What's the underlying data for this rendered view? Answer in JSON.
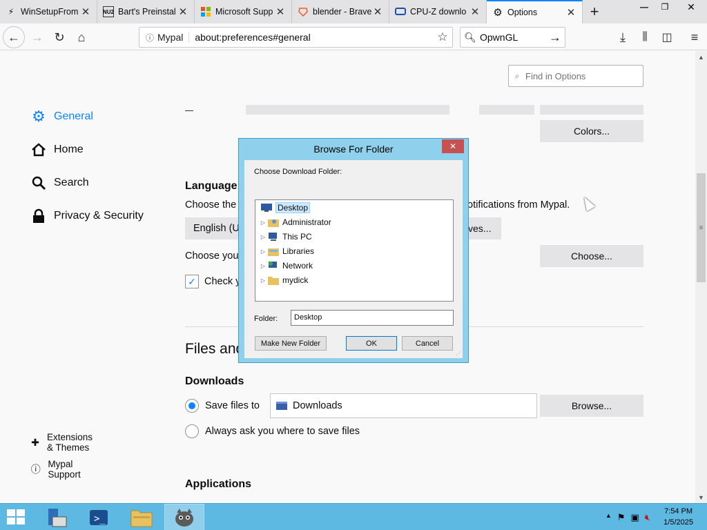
{
  "tabs": [
    {
      "title": "WinSetupFrom",
      "icon": "usb-icon"
    },
    {
      "title": "Bart's Preinstal",
      "icon": "nu2-icon"
    },
    {
      "title": "Microsoft Supp",
      "icon": "microsoft-icon"
    },
    {
      "title": "blender - Brave",
      "icon": "brave-icon"
    },
    {
      "title": "CPU-Z downlo",
      "icon": "cpuz-icon"
    },
    {
      "title": "Options",
      "icon": "gear-icon",
      "active": true
    }
  ],
  "toolbar": {
    "identity": "Mypal",
    "url": "about:preferences#general",
    "search_value": "OpwnGL"
  },
  "find": {
    "placeholder": "Find in Options"
  },
  "sidebar": {
    "items": [
      {
        "label": "General",
        "icon": "gear-icon",
        "active": true
      },
      {
        "label": "Home",
        "icon": "home-icon"
      },
      {
        "label": "Search",
        "icon": "search-icon"
      },
      {
        "label": "Privacy & Security",
        "icon": "lock-icon"
      }
    ],
    "footer": [
      {
        "label": "Extensions & Themes",
        "icon": "puzzle-icon"
      },
      {
        "label": "Mypal Support",
        "icon": "help-icon"
      }
    ]
  },
  "main": {
    "colors_button": "Colors...",
    "language_heading": "Language",
    "language_text_start": "Choose the",
    "language_text_end": "otifications from Mypal.",
    "language_select": "English (U",
    "alternatives_button_end": "ves...",
    "choose_text": "Choose you",
    "choose_button": "Choose...",
    "check_text": "Check y",
    "files_heading": "Files and",
    "downloads_heading": "Downloads",
    "save_files_label": "Save files to",
    "download_path": "Downloads",
    "browse_button": "Browse...",
    "always_ask_label": "Always ask you where to save files",
    "applications_heading": "Applications"
  },
  "dialog": {
    "title": "Browse For Folder",
    "prompt": "Choose Download Folder:",
    "tree": [
      {
        "label": "Desktop",
        "selected": true,
        "expandable": false
      },
      {
        "label": "Administrator",
        "expandable": true
      },
      {
        "label": "This PC",
        "expandable": true
      },
      {
        "label": "Libraries",
        "expandable": true
      },
      {
        "label": "Network",
        "expandable": true
      },
      {
        "label": "mydick",
        "expandable": true
      }
    ],
    "folder_label": "Folder:",
    "folder_value": "Desktop",
    "make_new_folder": "Make New Folder",
    "ok": "OK",
    "cancel": "Cancel"
  },
  "taskbar": {
    "time": "7:54 PM",
    "date": "1/5/2025"
  }
}
